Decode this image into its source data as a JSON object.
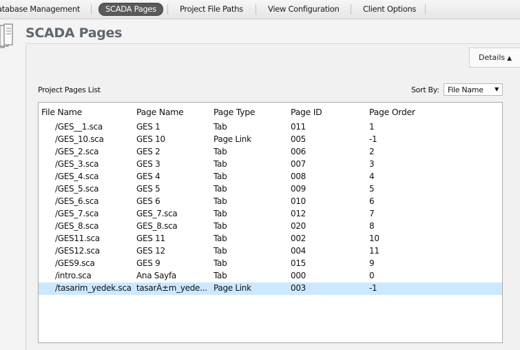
{
  "nav": {
    "items": [
      {
        "label": "atabase Management",
        "active": false
      },
      {
        "label": "SCADA Pages",
        "active": true
      },
      {
        "label": "Project File Paths",
        "active": false
      },
      {
        "label": "View Configuration",
        "active": false
      },
      {
        "label": "Client Options",
        "active": false
      }
    ]
  },
  "page": {
    "title": "SCADA Pages",
    "details_label": "Details",
    "list_label": "Project Pages List",
    "sort_label": "Sort By:",
    "sort_value": "File Name"
  },
  "table": {
    "columns": [
      "File Name",
      "Page Name",
      "Page Type",
      "Page ID",
      "Page Order"
    ],
    "rows": [
      [
        "/GES__1.sca",
        "GES 1",
        "Tab",
        "011",
        "1"
      ],
      [
        "/GES_10.sca",
        "GES 10",
        "Page Link",
        "005",
        "-1"
      ],
      [
        "/GES_2.sca",
        "GES 2",
        "Tab",
        "006",
        "2"
      ],
      [
        "/GES_3.sca",
        "GES 3",
        "Tab",
        "007",
        "3"
      ],
      [
        "/GES_4.sca",
        "GES 4",
        "Tab",
        "008",
        "4"
      ],
      [
        "/GES_5.sca",
        "GES 5",
        "Tab",
        "009",
        "5"
      ],
      [
        "/GES_6.sca",
        "GES 6",
        "Tab",
        "010",
        "6"
      ],
      [
        "/GES_7.sca",
        "GES_7.sca",
        "Tab",
        "012",
        "7"
      ],
      [
        "/GES_8.sca",
        "GES_8.sca",
        "Tab",
        "020",
        "8"
      ],
      [
        "/GES11.sca",
        "GES 11",
        "Tab",
        "002",
        "10"
      ],
      [
        "/GES12.sca",
        "GES 12",
        "Tab",
        "004",
        "11"
      ],
      [
        "/GES9.sca",
        "GES 9",
        "Tab",
        "015",
        "9"
      ],
      [
        "/intro.sca",
        "Ana Sayfa",
        "Tab",
        "000",
        "0"
      ],
      [
        "/tasarim_yedek.sca",
        "tasarÄ±m_yede...",
        "Page Link",
        "003",
        "-1"
      ]
    ],
    "selected_row": 13,
    "selected_color": "#cce8ff"
  }
}
